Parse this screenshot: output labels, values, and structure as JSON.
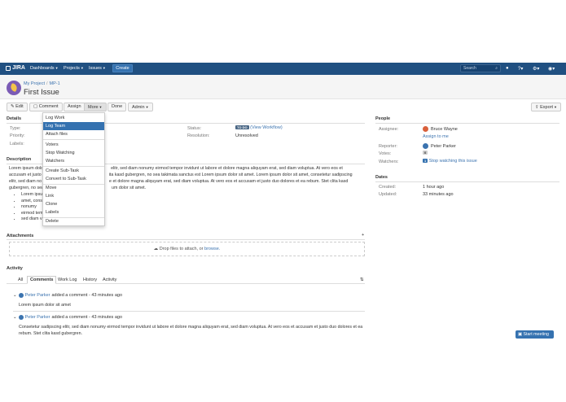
{
  "header": {
    "logo": "JIRA",
    "nav": [
      "Dashboards",
      "Projects",
      "Issues"
    ],
    "create": "Create",
    "search_placeholder": "Search"
  },
  "issue": {
    "breadcrumb_project": "My Project",
    "breadcrumb_key": "MP-1",
    "title": "First Issue"
  },
  "toolbar": {
    "edit": "Edit",
    "comment": "Comment",
    "assign": "Assign",
    "more": "More",
    "done": "Done",
    "admin": "Admin",
    "export": "Export"
  },
  "more_menu": {
    "items": [
      "Log Work",
      "Log Team",
      "Attach files",
      "Voters",
      "Stop Watching",
      "Watchers",
      "Create Sub-Task",
      "Convert to Sub-Task",
      "Move",
      "Link",
      "Clone",
      "Labels",
      "Delete"
    ],
    "active_index": 1
  },
  "details": {
    "heading": "Details",
    "type_label": "Type:",
    "priority_label": "Priority:",
    "labels_label": "Labels:",
    "status_label": "Status:",
    "status_value": "TO DO",
    "view_workflow": "(View Workflow)",
    "resolution_label": "Resolution:",
    "resolution_value": "Unresolved"
  },
  "description": {
    "heading": "Description",
    "line1": "Lorem ipsum dolo",
    "line1b": "elitr, sed diam nonumy eirmod tempor invidunt ut labore et dolore magna aliquyam erat, sed diam voluptua. At vero eos et",
    "line2": "accusam et justo",
    "line2b": "ita kasd gubergren, no sea takimata sanctus est Lorem ipsum dolor sit amet. Lorem ipsum dolor sit amet, consetetur sadipscing",
    "line3": "elitr, sed diam no",
    "line3b": "e et dolore magna aliquyam erat, sed diam voluptua. At vero eos et accusam et justo duo dolores et ea rebum. Stet clita kasd",
    "line4": "gubergren, no sea",
    "line4b": "um dolor sit amet.",
    "list": [
      "Lorem ipsum",
      "amet, conse",
      "nonumy",
      "eirmod tem",
      "sed diam v"
    ]
  },
  "attachments": {
    "heading": "Attachments",
    "drop_text": "Drop files to attach, or ",
    "browse": "browse."
  },
  "activity": {
    "heading": "Activity",
    "tabs": [
      "All",
      "Comments",
      "Work Log",
      "History",
      "Activity"
    ],
    "active_tab": "Comments",
    "comments": [
      {
        "author": "Peter Parker",
        "meta": "added a comment - 43 minutes ago",
        "body": "Lorem ipsum dolor sit amet"
      },
      {
        "author": "Peter Parker",
        "meta": "added a comment - 43 minutes ago",
        "body1": "Consetetur sadipscing elitr, sed diam nonumy eirmod tempor invidunt ut labore et dolore magna aliquyam erat, sed diam voluptua. At vero eos et accusam et justo duo dolores et ea",
        "body2": "rebum. Stet clita kasd gubergren."
      }
    ]
  },
  "people": {
    "heading": "People",
    "assignee_label": "Assignee:",
    "assignee": "Bruce Wayne",
    "assign_to_me": "Assign to me",
    "reporter_label": "Reporter:",
    "reporter": "Peter Parker",
    "votes_label": "Votes:",
    "votes": "0",
    "watchers_label": "Watchers:",
    "watchers_count": "1",
    "stop_watching": "Stop watching this issue"
  },
  "dates": {
    "heading": "Dates",
    "created_label": "Created:",
    "created": "1 hour ago",
    "updated_label": "Updated:",
    "updated": "33 minutes ago"
  },
  "start_meeting": "Start meeting",
  "colors": {
    "header": "#205081",
    "accent": "#3572b0",
    "link": "#3b73af"
  }
}
